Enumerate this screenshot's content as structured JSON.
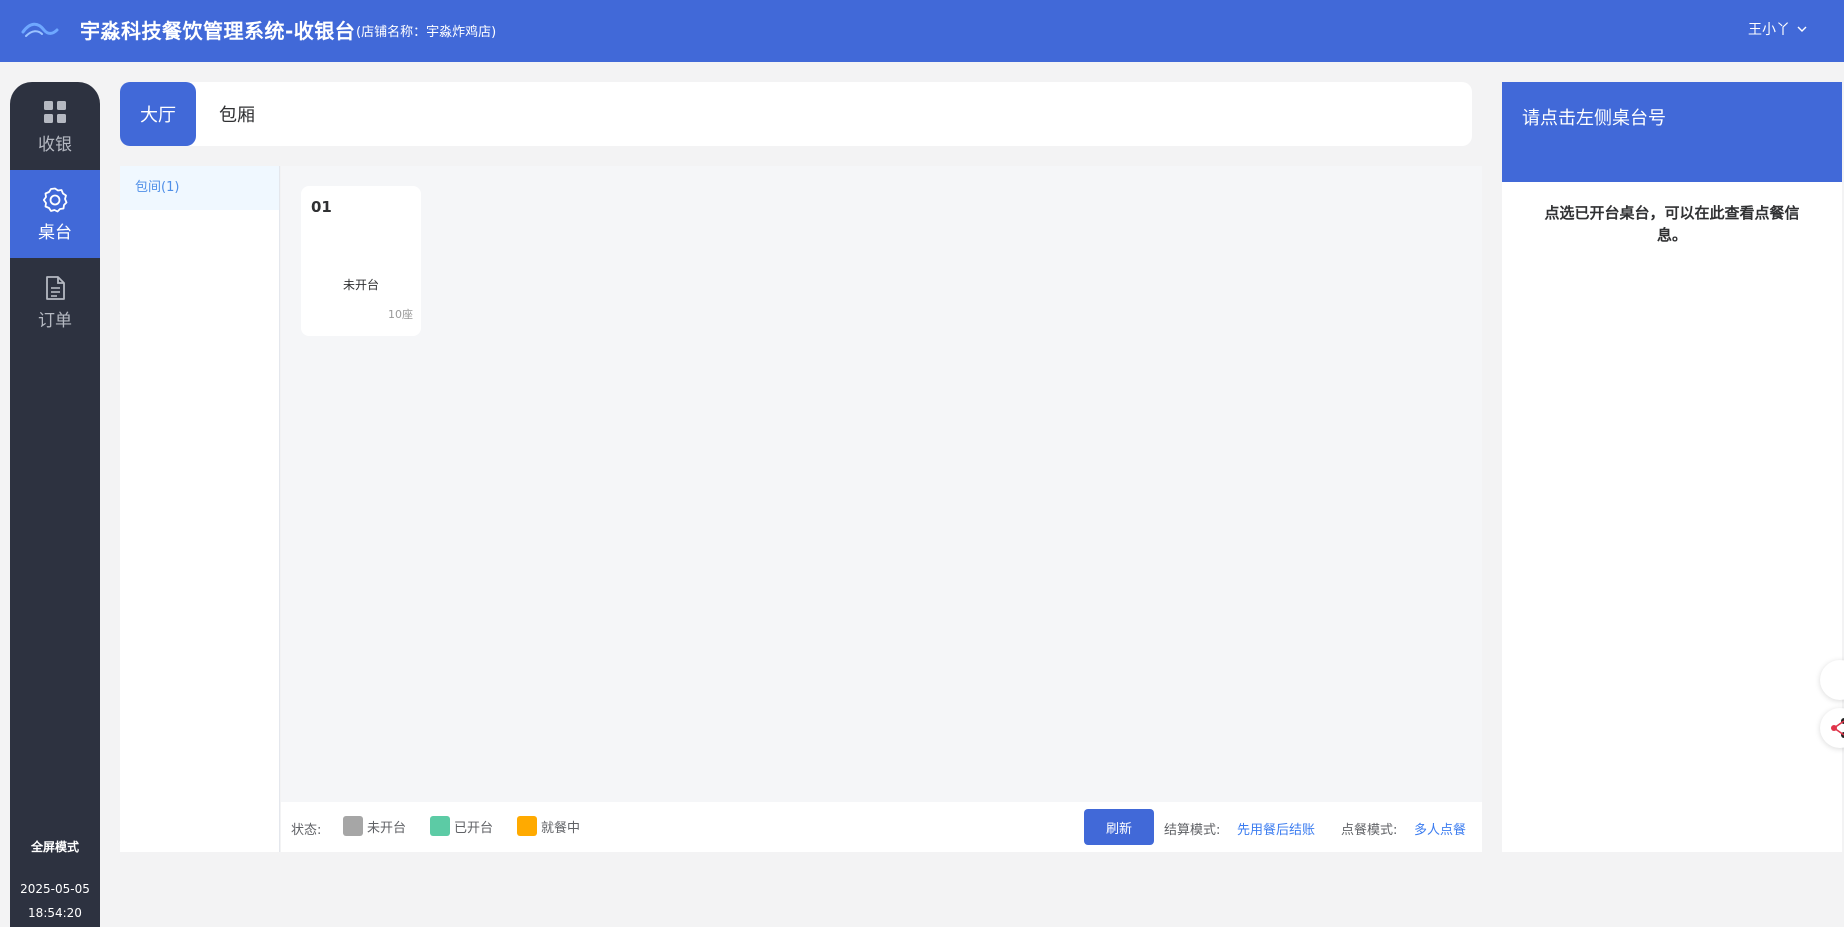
{
  "header": {
    "title": "宇淼科技餐饮管理系统-收银台",
    "store": "(店铺名称：宇淼炸鸡店)",
    "user": "王小丫"
  },
  "sidebar": {
    "items": [
      {
        "label": "收银",
        "icon": "grid-icon"
      },
      {
        "label": "桌台",
        "icon": "gear-icon"
      },
      {
        "label": "订单",
        "icon": "document-icon"
      }
    ],
    "active": "桌台",
    "fullscreen_label": "全屏模式",
    "date": "2025-05-05",
    "time": "18:54:20"
  },
  "area_tabs": [
    {
      "label": "大厅",
      "active": true
    },
    {
      "label": "包厢",
      "active": false
    }
  ],
  "categories": [
    {
      "label": "包间(1)",
      "active": true
    }
  ],
  "tables": [
    {
      "number": "01",
      "status": "未开台",
      "seats": "10座"
    }
  ],
  "status_bar": {
    "status_label": "状态:",
    "legend": [
      {
        "label": "未开台",
        "color": "#a6a6a6"
      },
      {
        "label": "已开台",
        "color": "#5ccba5"
      },
      {
        "label": "就餐中",
        "color": "#ffaa00"
      }
    ],
    "refresh_label": "刷新",
    "settle_mode_label": "结算模式:",
    "settle_mode_value": "先用餐后结账",
    "order_mode_label": "点餐模式:",
    "order_mode_value": "多人点餐"
  },
  "detail": {
    "title": "请点击左侧桌台号",
    "hint": "点选已开台桌台，可以在此查看点餐信息。"
  },
  "colors": {
    "primary": "#4169d8",
    "sidebar_bg": "#2d3240",
    "link": "#3b7cf0"
  }
}
